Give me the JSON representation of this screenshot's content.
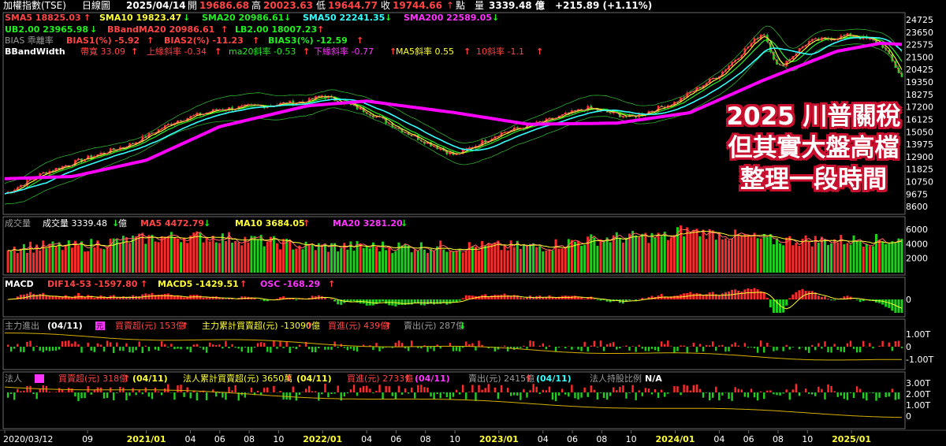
{
  "colors": {
    "up": "#ff2a2a",
    "down": "#1fd01f",
    "yellow": "#ffff33",
    "cyan": "#33ffff",
    "magenta": "#ff00ff",
    "green": "#22ee22",
    "white": "#ffffff",
    "grey": "#9a9a9a",
    "redtxt": "#ff4444",
    "gold": "#d4b000",
    "annot": "#c8102e"
  },
  "header": {
    "index_name": "加權指數(TSE)",
    "chart_kind": "日線圖",
    "date": "2025/04/14",
    "open_label": "開",
    "open": "19686.68",
    "high_label": "高",
    "high": "20023.63",
    "low_label": "低",
    "low": "19644.77",
    "close_label": "收",
    "close": "19744.66",
    "unit": "點",
    "volume_label": "量",
    "volume": "3339.48 億",
    "change": "+215.89 (+1.11%)"
  },
  "legend_main": {
    "sma5": "SMA5 18825.03",
    "sma10": "SMA10 19823.47",
    "sma20": "SMA20 20986.61",
    "sma50": "SMA50 22241.35",
    "sma200": "SMA200 22589.05",
    "ub": "UB2.00 23965.98",
    "bbma": "BBandMA20 20986.61",
    "lb": "LB2.00 18007.23",
    "bias_name": "BIAS 乖離率",
    "bias1": "BIAS1(%) -5.92",
    "bias2": "BIAS2(%) -11.23",
    "bias3": "BIAS3(%) -12.59",
    "bbw_name": "BBandWidth",
    "bw": "帶寬 33.09",
    "up_slope": "上緣斜率 -0.34",
    "ma20_slope": "ma20斜率 -0.53",
    "down_slope": "下緣斜率 -0.77",
    "ma5_slope": "MA5斜率 0.55",
    "ten_slope": "10斜率 -1.1"
  },
  "legend_volume": {
    "name": "成交量",
    "vol": "成交量 3339.48",
    "unit": "億",
    "ma5": "MA5 4472.79",
    "ma10": "MA10 3684.05",
    "ma20": "MA20 3281.20"
  },
  "legend_macd": {
    "name": "MACD",
    "dif": "DIF14-53 -1597.80",
    "macd": "MACD5 -1429.51",
    "osc": "OSC -168.29"
  },
  "legend_main_force": {
    "name": "主力進出",
    "date": "(04/11)",
    "tag": "元",
    "buy_sell": "買賣超(元) 153億",
    "cum": "主力累計買賣超(元) -13090億",
    "buy": "買進(元) 439億",
    "sell": "賣出(元) 287億"
  },
  "legend_inst": {
    "name": "法人",
    "buy_sell": "買賣超(元) 318億",
    "d1": "(04/11)",
    "cum": "法人累計買賣超(元) 3650萬",
    "d2": "(04/11)",
    "buy": "買進(元) 2733億",
    "d3": "(04/11)",
    "sell": "賣出(元) 2415億",
    "d4": "(04/11)",
    "hold": "法人持股比例",
    "hold_val": "N/A"
  },
  "annotation": [
    "2025 川普關稅",
    "但其實大盤高檔",
    "整理一段時間"
  ],
  "chart_data": {
    "type": "candlestick",
    "title": "加權指數(TSE) 日線圖",
    "x_range": [
      "2020/03/12",
      "2025/04/14"
    ],
    "x_ticks": [
      "2020/03/12",
      "09",
      "2021/01",
      "04",
      "06",
      "08",
      "10",
      "2022/01",
      "04",
      "06",
      "08",
      "10",
      "2023/01",
      "04",
      "06",
      "08",
      "10",
      "2024/01",
      "04",
      "06",
      "08",
      "10",
      "2025/01"
    ],
    "price_ticks": [
      24725,
      23650,
      22575,
      21500,
      20425,
      19350,
      18275,
      17200,
      16125,
      15050,
      13975,
      12900,
      11825,
      10750,
      9675,
      8600
    ],
    "price_ylim": [
      8200,
      25200
    ],
    "close_path": {
      "dates": [
        "2020/03/12",
        "2020/06",
        "2020/09",
        "2020/12",
        "2021/03",
        "2021/06",
        "2021/09",
        "2021/12",
        "2022/01",
        "2022/04",
        "2022/07",
        "2022/10",
        "2023/01",
        "2023/04",
        "2023/07",
        "2023/10",
        "2024/01",
        "2024/04",
        "2024/07",
        "2024/08",
        "2024/10",
        "2025/01",
        "2025/03",
        "2025/04/14"
      ],
      "values": [
        9700,
        11500,
        12800,
        14000,
        16000,
        17000,
        17300,
        17700,
        18200,
        16800,
        14800,
        13000,
        14900,
        15900,
        17100,
        16300,
        17600,
        20000,
        23700,
        20500,
        22800,
        23400,
        22700,
        19745
      ]
    },
    "sma200_path": {
      "dates": [
        "2020/03/12",
        "2020/08",
        "2021/01",
        "2021/06",
        "2021/12",
        "2022/04",
        "2022/10",
        "2023/03",
        "2023/09",
        "2024/02",
        "2024/07",
        "2024/12",
        "2025/03",
        "2025/04/14"
      ],
      "values": [
        11000,
        11200,
        12600,
        15500,
        17300,
        17700,
        16700,
        15700,
        15800,
        16700,
        19500,
        22000,
        22700,
        22589
      ]
    },
    "volume_ticks": [
      6000,
      4000,
      2000
    ],
    "volume_ylim": [
      0,
      7000
    ],
    "macd_ticks": [
      0
    ],
    "main_force_ticks": [
      "1.00T",
      "0",
      "-1.00T"
    ],
    "inst_ticks": [
      "3.00T",
      "2.00T",
      "1.00T",
      "0"
    ]
  }
}
